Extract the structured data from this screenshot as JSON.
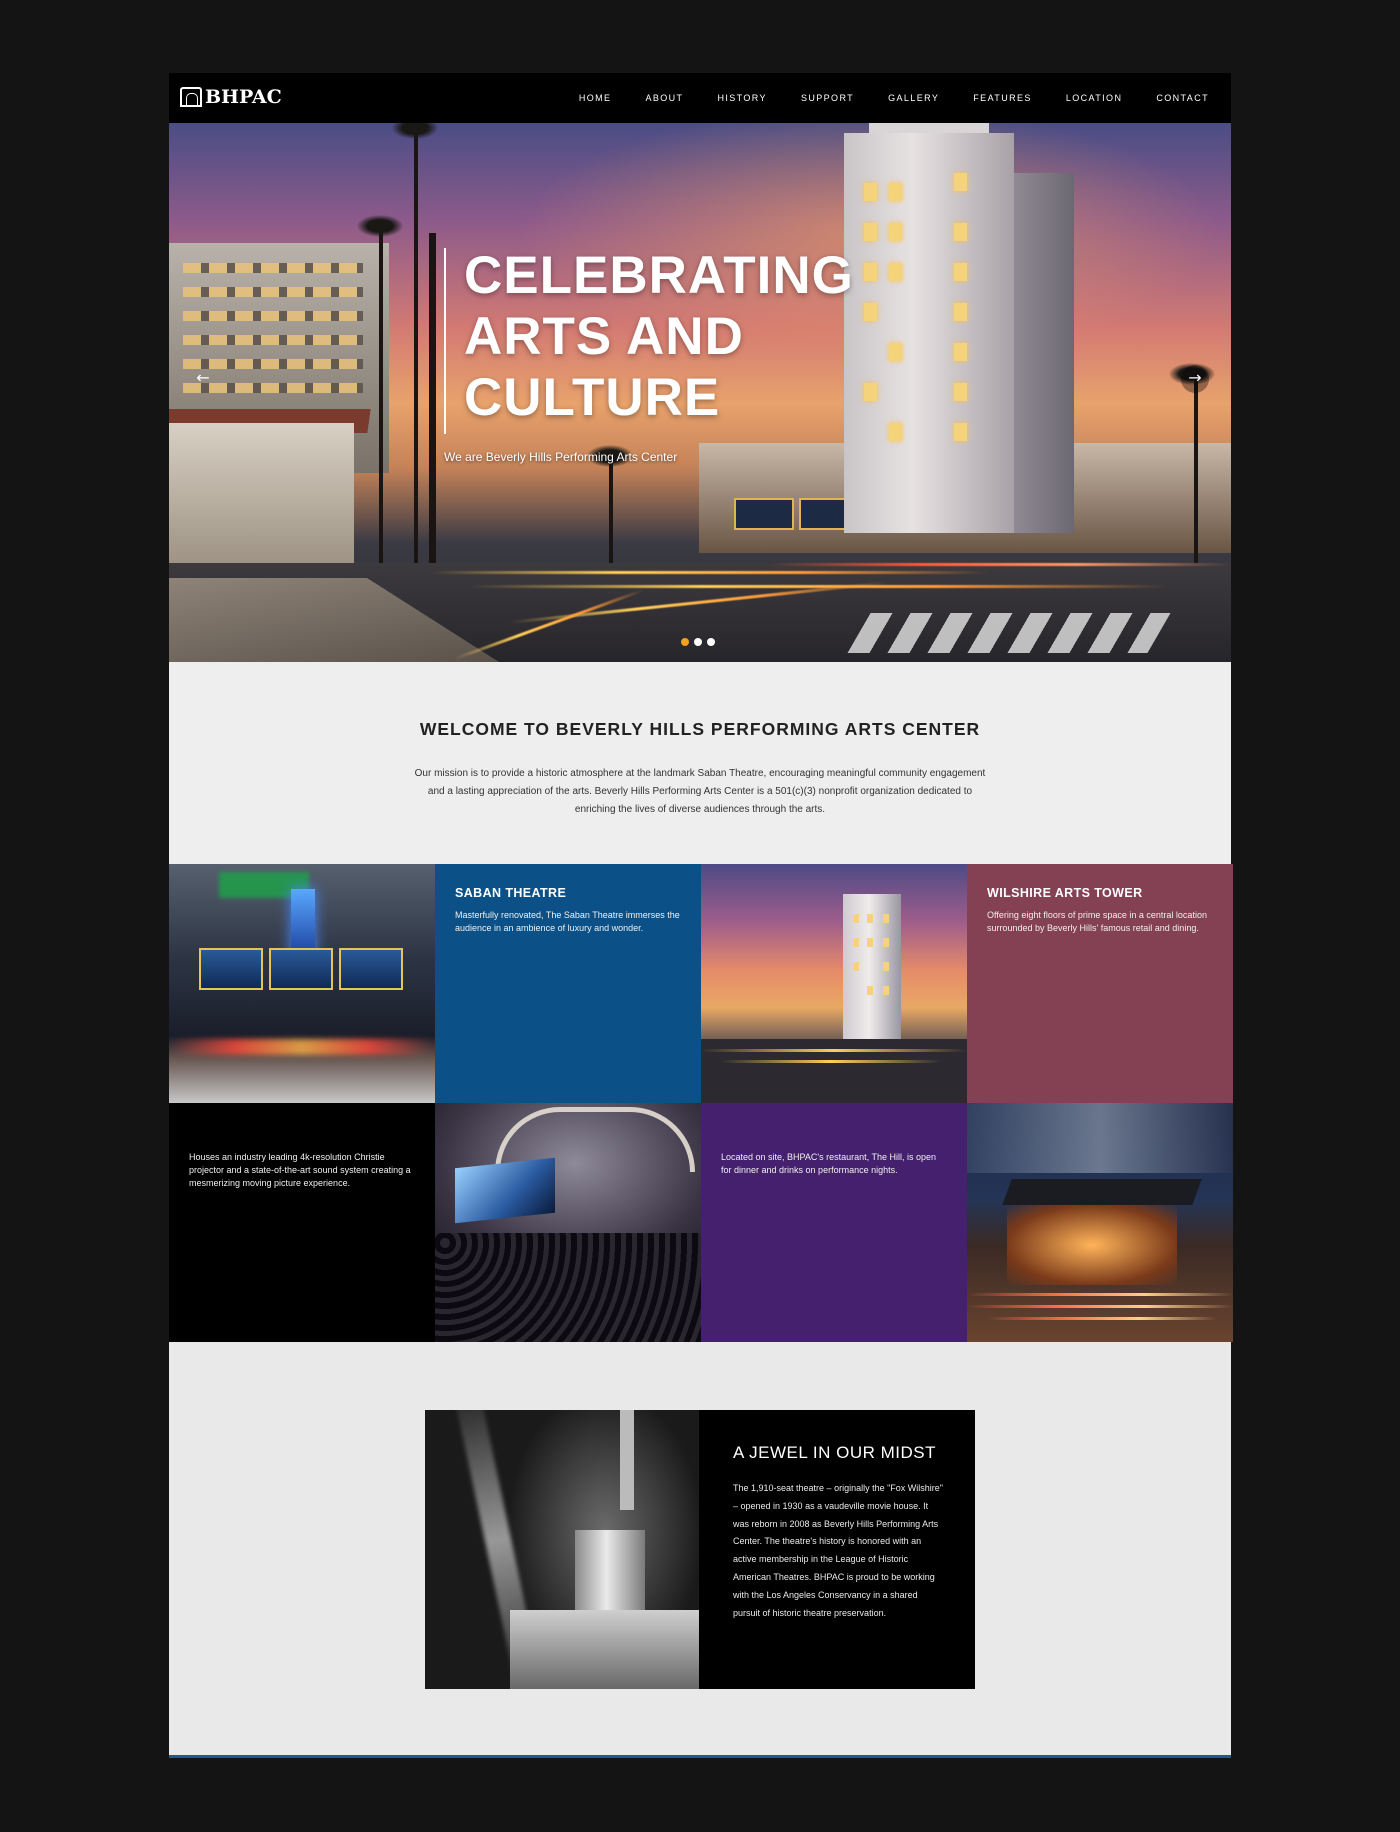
{
  "nav": {
    "logo_text": "BHPAC",
    "items": [
      "HOME",
      "ABOUT",
      "HISTORY",
      "SUPPORT",
      "GALLERY",
      "FEATURES",
      "LOCATION",
      "CONTACT"
    ]
  },
  "hero": {
    "title": "CELEBRATING ARTS AND CULTURE",
    "subtitle": "We are Beverly Hills Performing Arts Center",
    "prev_icon": "arrow-left-icon",
    "next_icon": "arrow-right-icon",
    "slides_total": 3,
    "active_slide": 1
  },
  "welcome": {
    "heading": "WELCOME TO BEVERLY HILLS PERFORMING ARTS CENTER",
    "body": "Our mission is to provide a historic atmosphere at the landmark Saban Theatre, encouraging meaningful community engagement and a lasting appreciation of the arts. Beverly Hills Performing Arts Center is a 501(c)(3) nonprofit organization dedicated to enriching the lives of diverse audiences through the arts."
  },
  "features": {
    "saban": {
      "title": "SABAN THEATRE",
      "text": "Masterfully renovated, The Saban Theatre immerses the audience in an ambience of luxury and wonder."
    },
    "wilshire": {
      "title": "WILSHIRE ARTS TOWER",
      "text": "Offering eight floors of prime space in a central location surrounded by Beverly Hills' famous retail and dining."
    },
    "cinema": {
      "text": "Houses an industry leading 4k-resolution Christie projector and a state-of-the-art sound system creating a mesmerizing moving picture experience."
    },
    "restaurant": {
      "text": "Located on site, BHPAC's restaurant, The Hill, is open for dinner and drinks on performance nights."
    }
  },
  "jewel": {
    "heading": "A JEWEL IN OUR MIDST",
    "body": "The 1,910-seat theatre – originally the \"Fox Wilshire\" – opened in 1930 as a vaudeville movie house. It was reborn in 2008 as Beverly Hills Performing Arts Center. The theatre's history is honored with an active membership in the League of Historic American Theatres. BHPAC is proud to be working with the Los Angeles Conservancy in a shared pursuit of historic theatre preservation."
  },
  "colors": {
    "nav_bg": "#000000",
    "saban_tile": "#0b5187",
    "wilshire_tile": "#834153",
    "cinema_tile": "#000000",
    "restaurant_tile": "#44206e",
    "slider_dot_active": "#f3a11f",
    "page_bg": "#141414"
  }
}
